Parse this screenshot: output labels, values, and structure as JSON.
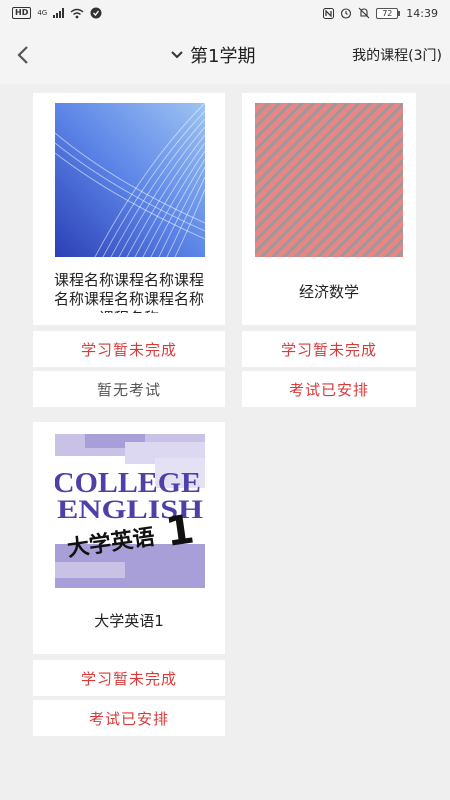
{
  "status_bar": {
    "hd": "HD",
    "net": "4G",
    "battery": "72",
    "time": "14:39"
  },
  "nav": {
    "title": "第1学期",
    "my_courses": "我的课程(3门)"
  },
  "courses": [
    {
      "name": "课程名称课程名称课程名称课程名称课程名称课程名称",
      "study_status": "学习暂未完成",
      "exam_status": "暂无考试"
    },
    {
      "name": "经济数学",
      "study_status": "学习暂未完成",
      "exam_status": "考试已安排"
    },
    {
      "name": "大学英语1",
      "study_status": "学习暂未完成",
      "exam_status": "考试已安排",
      "cover": {
        "line1": "COLLEGE",
        "line2": "ENGLISH",
        "line3": "大学英语",
        "num": "1"
      }
    }
  ],
  "colors": {
    "accent_red": "#d93a3a",
    "muted_text": "#555555",
    "page_bg": "#efefef"
  }
}
